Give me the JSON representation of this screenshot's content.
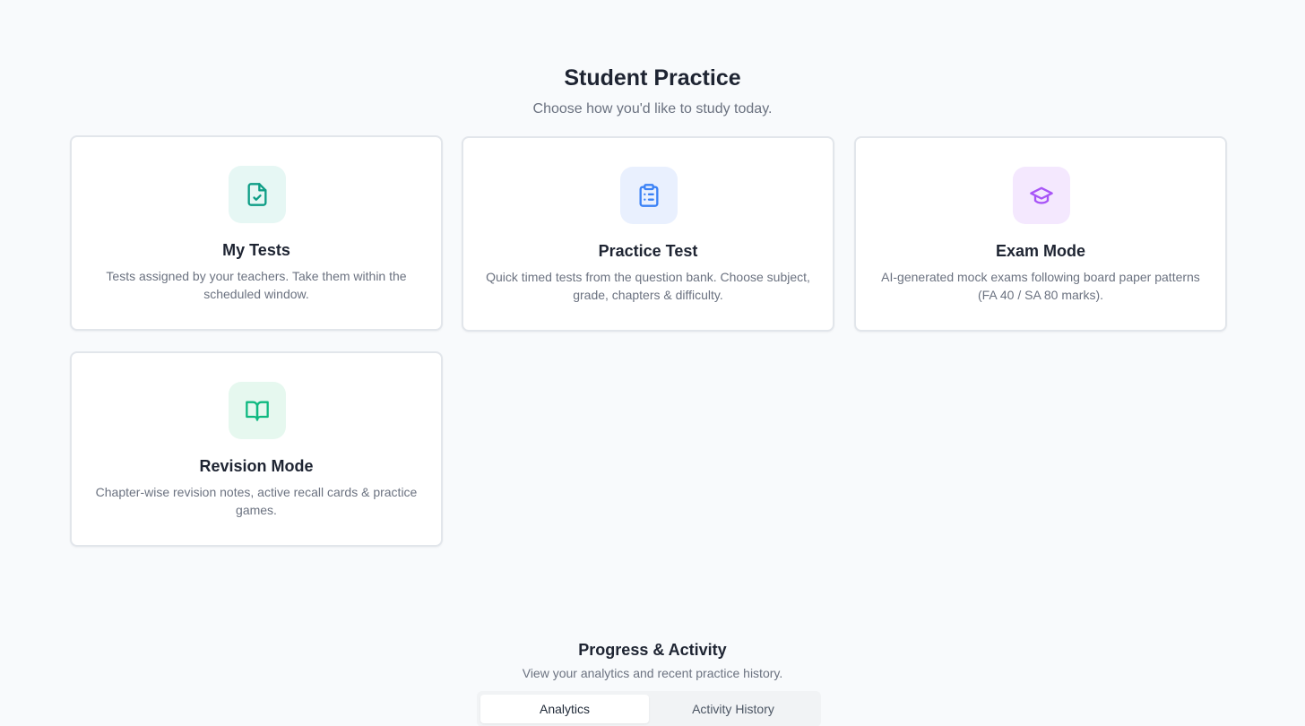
{
  "header": {
    "title": "Student Practice",
    "subtitle": "Choose how you'd like to study today."
  },
  "cards": [
    {
      "title": "My Tests",
      "description": "Tests assigned by your teachers. Take them within the scheduled window.",
      "icon": "file-check-icon",
      "accent": "#0f9e86"
    },
    {
      "title": "Practice Test",
      "description": "Quick timed tests from the question bank. Choose subject, grade, chapters & difficulty.",
      "icon": "clipboard-list-icon",
      "accent": "#3b82f6"
    },
    {
      "title": "Exam Mode",
      "description": "AI-generated mock exams following board paper patterns (FA 40 / SA 80 marks).",
      "icon": "graduation-cap-icon",
      "accent": "#a855f7"
    },
    {
      "title": "Revision Mode",
      "description": "Chapter-wise revision notes, active recall cards & practice games.",
      "icon": "book-open-icon",
      "accent": "#10b981"
    }
  ],
  "progress": {
    "title": "Progress & Activity",
    "subtitle": "View your analytics and recent practice history.",
    "tabs": [
      {
        "label": "Analytics",
        "active": true
      },
      {
        "label": "Activity History",
        "active": false
      }
    ]
  }
}
